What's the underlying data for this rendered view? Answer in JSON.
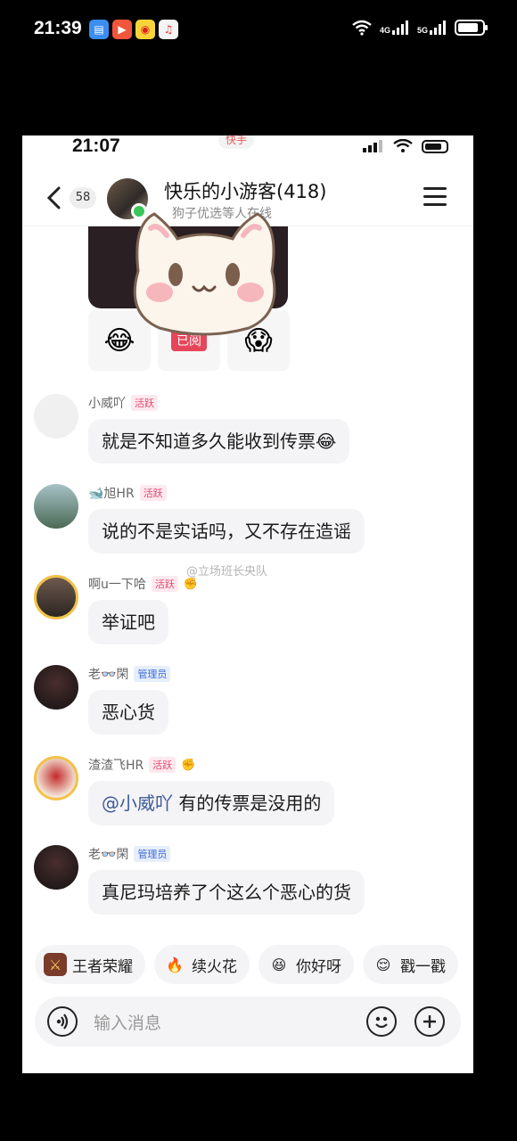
{
  "outer_status": {
    "time": "21:39",
    "net_a": "4G",
    "net_b": "5G"
  },
  "inner_status": {
    "time": "21:07",
    "app_tag": "快手"
  },
  "header": {
    "unread_count": "58",
    "group_title": "快乐的小游客(418)",
    "group_subtitle": "狗子优选等人在线"
  },
  "reactions": {
    "tag_label": "已阅"
  },
  "messages": [
    {
      "name": "小威吖",
      "role": "活跃",
      "text": "就是不知道多久能收到传票😂"
    },
    {
      "name": "🐋旭HR",
      "role": "活跃",
      "text": "说的不是实话吗，又不存在造谣"
    },
    {
      "name": "啊u一下哈",
      "role": "活跃",
      "text": "举证吧"
    },
    {
      "name": "老👓閑",
      "role": "管理员",
      "text": "恶心货"
    },
    {
      "name": "渣渣飞HR",
      "role": "活跃",
      "mention": "@小威吖",
      "text": "有的传票是没用的"
    },
    {
      "name": "老👓閑",
      "role": "管理员",
      "text": "真尼玛培养了个这么个恶心的货"
    }
  ],
  "watermark": "@立场班长央队",
  "quick_replies": [
    {
      "label": "王者荣耀",
      "icon": "game-icon"
    },
    {
      "label": "续火花",
      "icon": "fire-icon"
    },
    {
      "label": "你好呀",
      "icon": "hello-emoji-icon"
    },
    {
      "label": "戳一戳",
      "icon": "poke-emoji-icon"
    }
  ],
  "input": {
    "placeholder": "输入消息"
  },
  "colors": {
    "active_badge": "#e34b72",
    "admin_badge": "#3d6bd8",
    "online": "#3ac55b",
    "bubble": "#f4f4f6"
  }
}
